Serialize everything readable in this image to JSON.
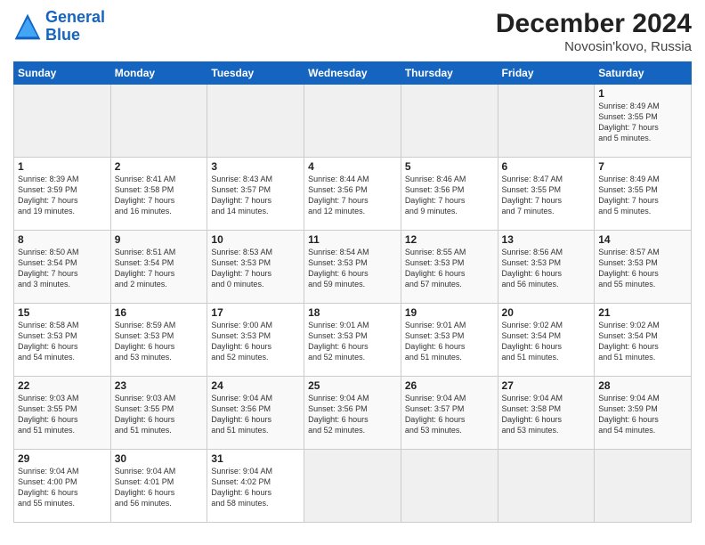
{
  "header": {
    "logo_line1": "General",
    "logo_line2": "Blue",
    "title": "December 2024",
    "subtitle": "Novosin'kovo, Russia"
  },
  "calendar": {
    "days_of_week": [
      "Sunday",
      "Monday",
      "Tuesday",
      "Wednesday",
      "Thursday",
      "Friday",
      "Saturday"
    ],
    "weeks": [
      [
        {
          "day": "",
          "empty": true
        },
        {
          "day": "",
          "empty": true
        },
        {
          "day": "",
          "empty": true
        },
        {
          "day": "",
          "empty": true
        },
        {
          "day": "",
          "empty": true
        },
        {
          "day": "",
          "empty": true
        },
        {
          "day": "1",
          "content": "Sunrise: 8:49 AM\nSunset: 3:55 PM\nDaylight: 7 hours\nand 5 minutes."
        }
      ],
      [
        {
          "day": "1",
          "content": "Sunrise: 8:39 AM\nSunset: 3:59 PM\nDaylight: 7 hours\nand 19 minutes."
        },
        {
          "day": "2",
          "content": "Sunrise: 8:41 AM\nSunset: 3:58 PM\nDaylight: 7 hours\nand 16 minutes."
        },
        {
          "day": "3",
          "content": "Sunrise: 8:43 AM\nSunset: 3:57 PM\nDaylight: 7 hours\nand 14 minutes."
        },
        {
          "day": "4",
          "content": "Sunrise: 8:44 AM\nSunset: 3:56 PM\nDaylight: 7 hours\nand 12 minutes."
        },
        {
          "day": "5",
          "content": "Sunrise: 8:46 AM\nSunset: 3:56 PM\nDaylight: 7 hours\nand 9 minutes."
        },
        {
          "day": "6",
          "content": "Sunrise: 8:47 AM\nSunset: 3:55 PM\nDaylight: 7 hours\nand 7 minutes."
        },
        {
          "day": "7",
          "content": "Sunrise: 8:49 AM\nSunset: 3:55 PM\nDaylight: 7 hours\nand 5 minutes."
        }
      ],
      [
        {
          "day": "8",
          "content": "Sunrise: 8:50 AM\nSunset: 3:54 PM\nDaylight: 7 hours\nand 3 minutes."
        },
        {
          "day": "9",
          "content": "Sunrise: 8:51 AM\nSunset: 3:54 PM\nDaylight: 7 hours\nand 2 minutes."
        },
        {
          "day": "10",
          "content": "Sunrise: 8:53 AM\nSunset: 3:53 PM\nDaylight: 7 hours\nand 0 minutes."
        },
        {
          "day": "11",
          "content": "Sunrise: 8:54 AM\nSunset: 3:53 PM\nDaylight: 6 hours\nand 59 minutes."
        },
        {
          "day": "12",
          "content": "Sunrise: 8:55 AM\nSunset: 3:53 PM\nDaylight: 6 hours\nand 57 minutes."
        },
        {
          "day": "13",
          "content": "Sunrise: 8:56 AM\nSunset: 3:53 PM\nDaylight: 6 hours\nand 56 minutes."
        },
        {
          "day": "14",
          "content": "Sunrise: 8:57 AM\nSunset: 3:53 PM\nDaylight: 6 hours\nand 55 minutes."
        }
      ],
      [
        {
          "day": "15",
          "content": "Sunrise: 8:58 AM\nSunset: 3:53 PM\nDaylight: 6 hours\nand 54 minutes."
        },
        {
          "day": "16",
          "content": "Sunrise: 8:59 AM\nSunset: 3:53 PM\nDaylight: 6 hours\nand 53 minutes."
        },
        {
          "day": "17",
          "content": "Sunrise: 9:00 AM\nSunset: 3:53 PM\nDaylight: 6 hours\nand 52 minutes."
        },
        {
          "day": "18",
          "content": "Sunrise: 9:01 AM\nSunset: 3:53 PM\nDaylight: 6 hours\nand 52 minutes."
        },
        {
          "day": "19",
          "content": "Sunrise: 9:01 AM\nSunset: 3:53 PM\nDaylight: 6 hours\nand 51 minutes."
        },
        {
          "day": "20",
          "content": "Sunrise: 9:02 AM\nSunset: 3:54 PM\nDaylight: 6 hours\nand 51 minutes."
        },
        {
          "day": "21",
          "content": "Sunrise: 9:02 AM\nSunset: 3:54 PM\nDaylight: 6 hours\nand 51 minutes."
        }
      ],
      [
        {
          "day": "22",
          "content": "Sunrise: 9:03 AM\nSunset: 3:55 PM\nDaylight: 6 hours\nand 51 minutes."
        },
        {
          "day": "23",
          "content": "Sunrise: 9:03 AM\nSunset: 3:55 PM\nDaylight: 6 hours\nand 51 minutes."
        },
        {
          "day": "24",
          "content": "Sunrise: 9:04 AM\nSunset: 3:56 PM\nDaylight: 6 hours\nand 51 minutes."
        },
        {
          "day": "25",
          "content": "Sunrise: 9:04 AM\nSunset: 3:56 PM\nDaylight: 6 hours\nand 52 minutes."
        },
        {
          "day": "26",
          "content": "Sunrise: 9:04 AM\nSunset: 3:57 PM\nDaylight: 6 hours\nand 53 minutes."
        },
        {
          "day": "27",
          "content": "Sunrise: 9:04 AM\nSunset: 3:58 PM\nDaylight: 6 hours\nand 53 minutes."
        },
        {
          "day": "28",
          "content": "Sunrise: 9:04 AM\nSunset: 3:59 PM\nDaylight: 6 hours\nand 54 minutes."
        }
      ],
      [
        {
          "day": "29",
          "content": "Sunrise: 9:04 AM\nSunset: 4:00 PM\nDaylight: 6 hours\nand 55 minutes."
        },
        {
          "day": "30",
          "content": "Sunrise: 9:04 AM\nSunset: 4:01 PM\nDaylight: 6 hours\nand 56 minutes."
        },
        {
          "day": "31",
          "content": "Sunrise: 9:04 AM\nSunset: 4:02 PM\nDaylight: 6 hours\nand 58 minutes."
        },
        {
          "day": "",
          "empty": true
        },
        {
          "day": "",
          "empty": true
        },
        {
          "day": "",
          "empty": true
        },
        {
          "day": "",
          "empty": true
        }
      ]
    ]
  }
}
